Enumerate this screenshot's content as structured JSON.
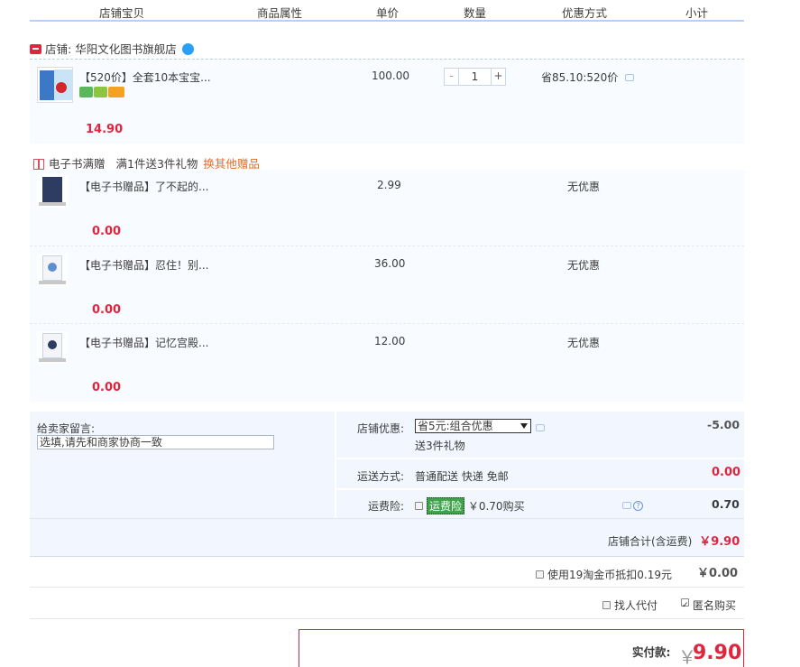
{
  "header": {
    "col_item": "店铺宝贝",
    "col_attr": "商品属性",
    "col_price": "单价",
    "col_qty": "数量",
    "col_discount": "优惠方式",
    "col_subtotal": "小计"
  },
  "shop": {
    "label": "店铺:",
    "name": "华阳文化图书旗舰店"
  },
  "main_item": {
    "title": "【520价】全套10本宝宝...",
    "price": "100.00",
    "qty": "1",
    "qty_minus": "-",
    "qty_plus": "+",
    "discount": "省85.10:520价",
    "subtotal": "14.90"
  },
  "promo": {
    "title": "电子书满赠",
    "rule": "满1件送3件礼物",
    "change_link": "换其他赠品"
  },
  "gifts": [
    {
      "title": "【电子书赠品】了不起的...",
      "price": "2.99",
      "discount": "无优惠",
      "subtotal": "0.00"
    },
    {
      "title": "【电子书赠品】忍住！别...",
      "price": "36.00",
      "discount": "无优惠",
      "subtotal": "0.00"
    },
    {
      "title": "【电子书赠品】记忆宫殿...",
      "price": "12.00",
      "discount": "无优惠",
      "subtotal": "0.00"
    }
  ],
  "order": {
    "message_label": "给卖家留言:",
    "message_placeholder": "选填,请先和商家协商一致",
    "shop_discount_label": "店铺优惠:",
    "shop_discount_selected": "省5元:组合优惠",
    "shop_discount_note": "送3件礼物",
    "shop_discount_amount": "-5.00",
    "shipping_label": "运送方式:",
    "shipping_value": "普通配送 快递 免邮",
    "shipping_amount": "0.00",
    "insurance_label": "运费险:",
    "insurance_name": "运费险",
    "insurance_price": "￥0.70购买",
    "insurance_amount": "0.70",
    "total_label": "店铺合计(含运费)",
    "total_value": "￥9.90"
  },
  "coins": {
    "label": "使用19淘金币抵扣0.19元",
    "value": "￥0.00"
  },
  "options": {
    "proxy_pay": "找人代付",
    "anonymous": "匿名购买"
  },
  "final": {
    "label": "实付款:",
    "currency": "￥",
    "amount": "9.90"
  }
}
